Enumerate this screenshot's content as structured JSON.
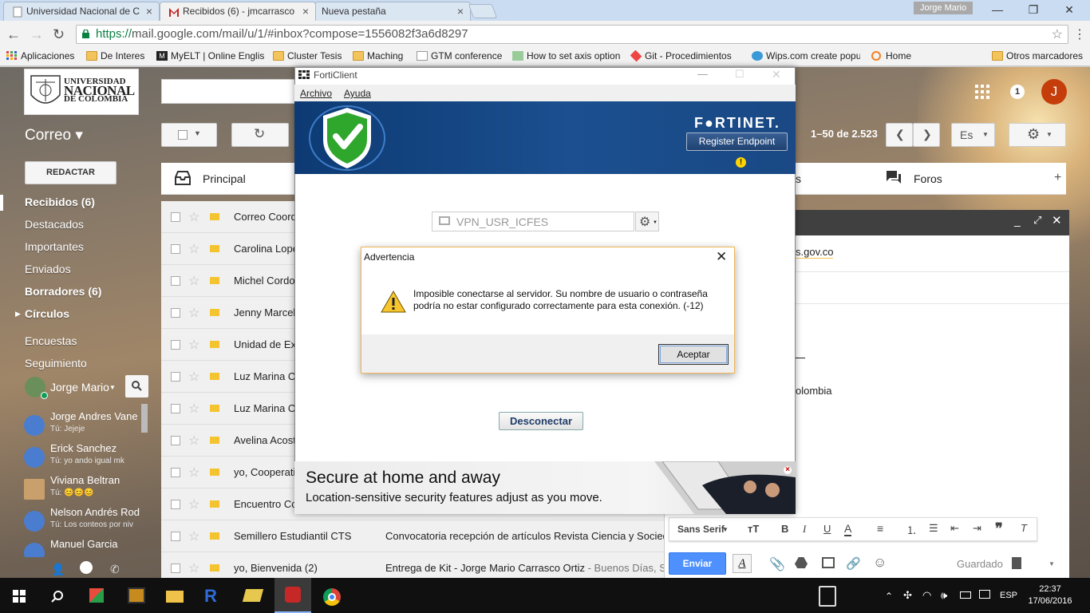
{
  "browser": {
    "tabs": [
      {
        "label": "Universidad Nacional de C"
      },
      {
        "label": "Recibidos (6) - jmcarrasco"
      },
      {
        "label": "Nueva pestaña"
      }
    ],
    "user": "Jorge Mario",
    "url_secure": "https://",
    "url_rest": "mail.google.com/mail/u/1/#inbox?compose=1556082f3a6d8297",
    "bookmarks": [
      "Aplicaciones",
      "De Interes",
      "MyELT | Online English",
      "Cluster Tesis",
      "Maching",
      "GTM conference",
      "How to set axis option",
      "Git - Procedimientos",
      "Wips.com create popu",
      "Home"
    ],
    "other_bookmarks": "Otros marcadores"
  },
  "gmail": {
    "logo": {
      "line1": "UNIVERSIDAD",
      "line2": "NACIONAL",
      "line3": "DE COLOMBIA"
    },
    "notifications": "1",
    "avatar_letter": "J",
    "section": "Correo ▾",
    "pager": "1–50 de 2.523",
    "lang_btn": "Es",
    "compose_btn": "REDACTAR",
    "nav": [
      "Recibidos (6)",
      "Destacados",
      "Importantes",
      "Enviados",
      "Borradores (6)",
      "Círculos",
      "Encuestas",
      "Seguimiento"
    ],
    "me": "Jorge Mario",
    "contacts": [
      {
        "name": "Jorge Andres Vane",
        "status": "Tú: Jejeje"
      },
      {
        "name": "Erick Sanchez",
        "status": "Tú: yo ando igual mk"
      },
      {
        "name": "Viviana Beltran",
        "status": "Tú: 😊😊😊"
      },
      {
        "name": "Nelson Andrés Rod",
        "status": "Tú: Los conteos por niv"
      },
      {
        "name": "Manuel Garcia",
        "status": ""
      }
    ],
    "tabs": {
      "primary": "Principal",
      "forums": "Foros",
      "social_tail": "s"
    },
    "emails": [
      {
        "sender": "Correo Coord",
        "subject": "",
        "snippet": ""
      },
      {
        "sender": "Carolina Lope",
        "subject": "",
        "snippet": ""
      },
      {
        "sender": "Michel Cordo",
        "subject": "",
        "snippet": ""
      },
      {
        "sender": "Jenny Marcel",
        "subject": "",
        "snippet": ""
      },
      {
        "sender": "Unidad de Ex",
        "subject": "",
        "snippet": ""
      },
      {
        "sender": "Luz Marina O",
        "subject": "",
        "snippet": ""
      },
      {
        "sender": "Luz Marina O",
        "subject": "",
        "snippet": ""
      },
      {
        "sender": "Avelina Acost",
        "subject": "",
        "snippet": ""
      },
      {
        "sender": "yo, Cooperati",
        "subject": "",
        "snippet": ""
      },
      {
        "sender": "Encuentro Co",
        "subject": "",
        "snippet": ""
      },
      {
        "sender": "Semillero Estudiantil CTS",
        "subject": "Convocatoria recepción de artículos Revista Ciencia y Socied",
        "snippet": ""
      },
      {
        "sender": "yo, Bienvenida (2)",
        "subject": "Entrega de Kit - Jorge Mario Carrasco Ortiz",
        "snippet": " - Buenos Días, S"
      }
    ],
    "compose": {
      "to_tail": "s.gov.co",
      "body_tail": "olombia",
      "font": "Sans Serif",
      "send": "Enviar",
      "saved": "Guardado"
    }
  },
  "forticlient": {
    "title": "FortiClient",
    "menu": [
      "Archivo",
      "Ayuda"
    ],
    "brand": "F●RTINET.",
    "register": "Register Endpoint",
    "warn": "!",
    "vpn": "VPN_USR_ICFES",
    "disconnect": "Desconectar",
    "ad_title": "Secure at home and away",
    "ad_sub": "Location-sensitive security features adjust as you move."
  },
  "alert": {
    "title": "Advertencia",
    "message": "Imposible conectarse al servidor. Su nombre de usuario o contraseña podría no estar configurado correctamente para esta conexión. (-12)",
    "ok": "Aceptar"
  },
  "taskbar": {
    "time": "22:37",
    "date": "17/06/2016",
    "lang": "ESP"
  },
  "colors": {
    "gmail_red": "#c43d0b",
    "send_blue": "#4d90fe",
    "forti_blue": "#0d3a73"
  }
}
